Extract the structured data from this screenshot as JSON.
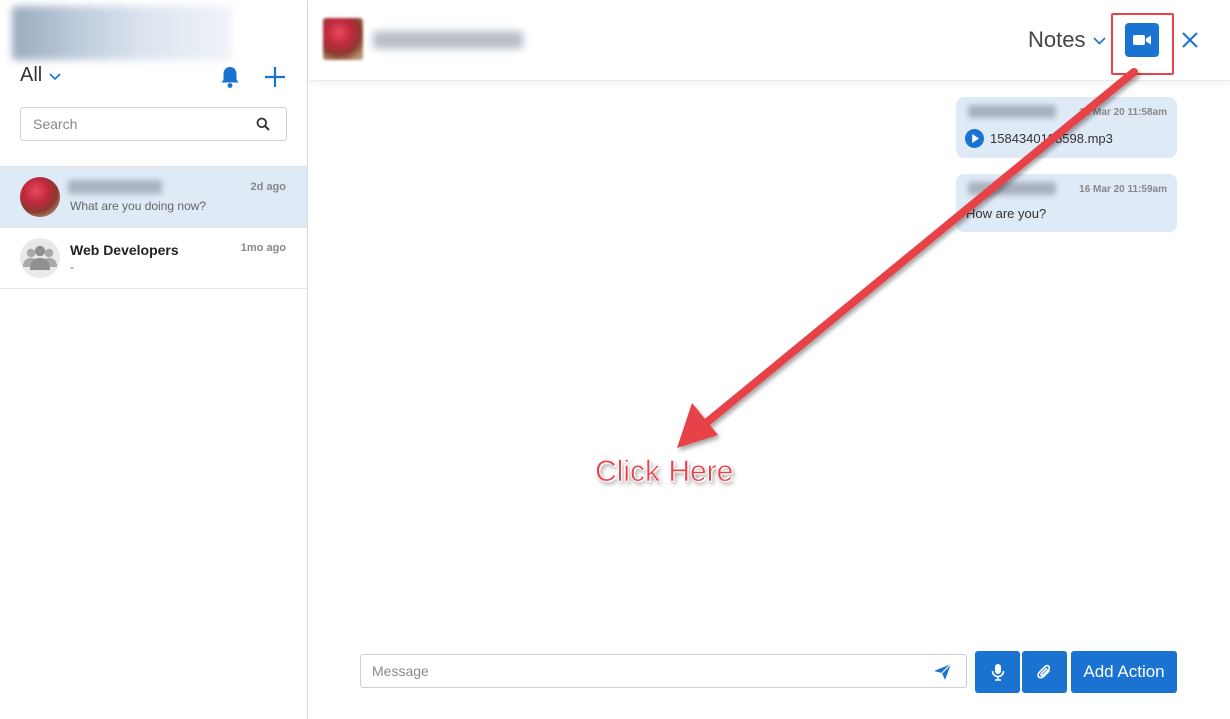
{
  "sidebar": {
    "filter_label": "All",
    "search_placeholder": "Search",
    "conversations": [
      {
        "name": "",
        "preview": "What are you doing now?",
        "time": "2d ago",
        "active": true
      },
      {
        "name": "Web Developers",
        "preview": "-",
        "time": "1mo ago",
        "active": false
      }
    ]
  },
  "header": {
    "notes_label": "Notes"
  },
  "messages": [
    {
      "timestamp": "16 Mar 20 11:58am",
      "file": "1584340198598.mp3"
    },
    {
      "timestamp": "16 Mar 20 11:59am",
      "text": "How are you?"
    }
  ],
  "composer": {
    "placeholder": "Message",
    "action_label": "Add Action"
  },
  "annotation": {
    "callout": "Click Here"
  },
  "colors": {
    "accent": "#1a73d1",
    "bubble": "#dfeaf7",
    "annotation": "#e8424a"
  }
}
